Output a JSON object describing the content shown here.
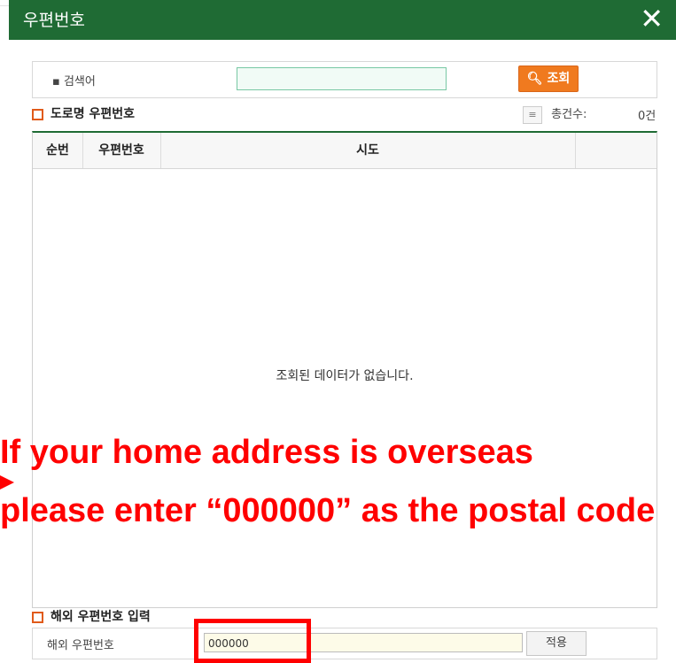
{
  "window": {
    "title": "우편번호",
    "close_icon": "close-icon"
  },
  "search": {
    "label": "검색어",
    "button_label": "조회",
    "button_icon": "search-icon",
    "input_value": ""
  },
  "road_section": {
    "title": "도로명 우편번호",
    "total_label": "총건수:",
    "total_value": "0건",
    "list_icon": "list-icon"
  },
  "grid": {
    "columns": [
      "순번",
      "우편번호",
      "시도"
    ],
    "empty_message": "조회된 데이터가 없습니다."
  },
  "overlay": {
    "line1": "If your home address is overseas",
    "line2": "please enter “000000” as the postal code",
    "color": "#ff0000"
  },
  "overseas": {
    "title": "해외 우편번호 입력",
    "label": "해외 우편번호",
    "value": "000000",
    "apply_label": "적용"
  },
  "colors": {
    "title_bar": "#1f6b34",
    "search_button": "#f07a1f",
    "highlight": "#ff0000"
  }
}
